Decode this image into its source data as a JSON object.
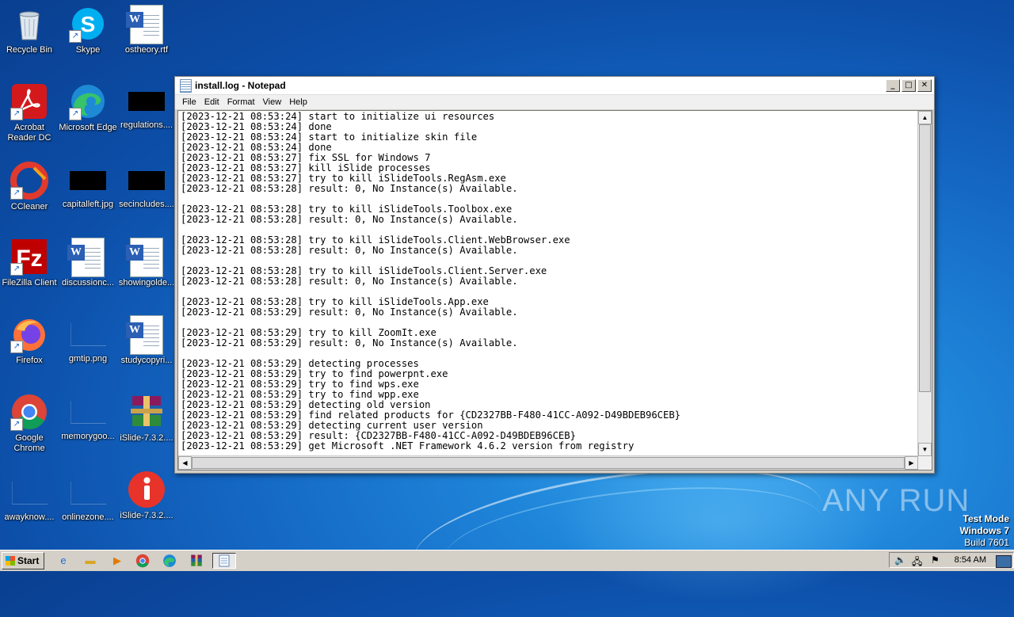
{
  "desktop": {
    "icons": [
      {
        "label": "Recycle Bin"
      },
      {
        "label": "Skype"
      },
      {
        "label": "ostheory.rtf"
      },
      {
        "label": "Acrobat Reader DC"
      },
      {
        "label": "Microsoft Edge"
      },
      {
        "label": "regulations...."
      },
      {
        "label": "CCleaner"
      },
      {
        "label": "capitalleft.jpg"
      },
      {
        "label": "secincludes...."
      },
      {
        "label": "FileZilla Client"
      },
      {
        "label": "discussionc..."
      },
      {
        "label": "showingolde..."
      },
      {
        "label": "Firefox"
      },
      {
        "label": "gmtip.png"
      },
      {
        "label": "studycopyri..."
      },
      {
        "label": "Google Chrome"
      },
      {
        "label": "memorygoo..."
      },
      {
        "label": "iSlide-7.3.2...."
      },
      {
        "label": "awayknow...."
      },
      {
        "label": "onlinezone...."
      },
      {
        "label": "iSlide-7.3.2...."
      }
    ],
    "watermark": "ANY RUN",
    "test_mode": {
      "line1": "Test Mode",
      "line2": "Windows 7",
      "line3": "Build 7601"
    }
  },
  "notepad": {
    "title": "install.log - Notepad",
    "menu": [
      "File",
      "Edit",
      "Format",
      "View",
      "Help"
    ],
    "content": "[2023-12-21 08:53:24] start to initialize ui resources\n[2023-12-21 08:53:24] done\n[2023-12-21 08:53:24] start to initialize skin file\n[2023-12-21 08:53:24] done\n[2023-12-21 08:53:27] fix SSL for Windows 7\n[2023-12-21 08:53:27] kill iSlide processes\n[2023-12-21 08:53:27] try to kill iSlideTools.RegAsm.exe\n[2023-12-21 08:53:28] result: 0, No Instance(s) Available.\n\n[2023-12-21 08:53:28] try to kill iSlideTools.Toolbox.exe\n[2023-12-21 08:53:28] result: 0, No Instance(s) Available.\n\n[2023-12-21 08:53:28] try to kill iSlideTools.Client.WebBrowser.exe\n[2023-12-21 08:53:28] result: 0, No Instance(s) Available.\n\n[2023-12-21 08:53:28] try to kill iSlideTools.Client.Server.exe\n[2023-12-21 08:53:28] result: 0, No Instance(s) Available.\n\n[2023-12-21 08:53:28] try to kill iSlideTools.App.exe\n[2023-12-21 08:53:29] result: 0, No Instance(s) Available.\n\n[2023-12-21 08:53:29] try to kill ZoomIt.exe\n[2023-12-21 08:53:29] result: 0, No Instance(s) Available.\n\n[2023-12-21 08:53:29] detecting processes\n[2023-12-21 08:53:29] try to find powerpnt.exe\n[2023-12-21 08:53:29] try to find wps.exe\n[2023-12-21 08:53:29] try to find wpp.exe\n[2023-12-21 08:53:29] detecting old version\n[2023-12-21 08:53:29] find related products for {CD2327BB-F480-41CC-A092-D49BDEB96CEB}\n[2023-12-21 08:53:29] detecting current user version\n[2023-12-21 08:53:29] result: {CD2327BB-F480-41CC-A092-D49BDEB96CEB}\n[2023-12-21 08:53:29] get Microsoft .NET Framework 4.6.2 version from registry"
  },
  "taskbar": {
    "start_label": "Start",
    "clock": "8:54 AM"
  }
}
